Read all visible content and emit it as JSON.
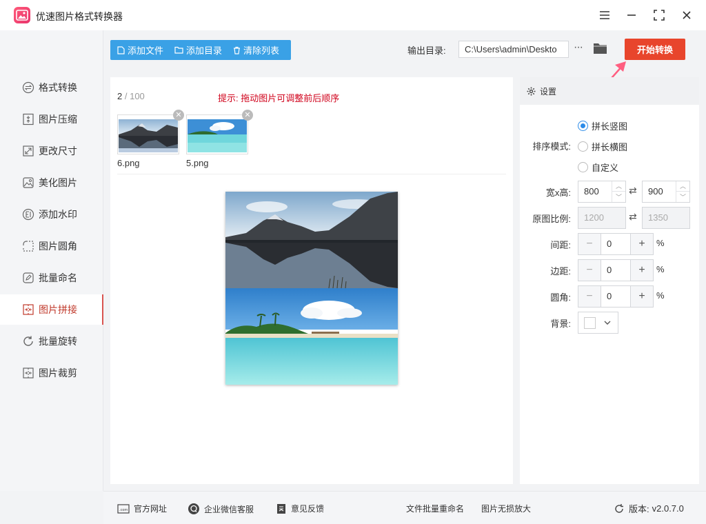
{
  "app": {
    "title": "优速图片格式转换器",
    "logo_icon": "image-icon"
  },
  "window_controls": [
    "menu-icon",
    "minimize-icon",
    "maximize-icon",
    "close-icon"
  ],
  "sidebar": {
    "active_index": 7,
    "items": [
      {
        "label": "格式转换",
        "icon": "format-convert-icon"
      },
      {
        "label": "图片压缩",
        "icon": "compress-icon"
      },
      {
        "label": "更改尺寸",
        "icon": "resize-icon"
      },
      {
        "label": "美化图片",
        "icon": "beautify-icon"
      },
      {
        "label": "添加水印",
        "icon": "watermark-icon"
      },
      {
        "label": "图片圆角",
        "icon": "rounded-corner-icon"
      },
      {
        "label": "批量命名",
        "icon": "rename-icon"
      },
      {
        "label": "图片拼接",
        "icon": "stitch-icon"
      },
      {
        "label": "批量旋转",
        "icon": "rotate-icon"
      },
      {
        "label": "图片裁剪",
        "icon": "crop-icon"
      }
    ]
  },
  "toolbar": {
    "add_file": "添加文件",
    "add_folder": "添加目录",
    "clear_list": "清除列表",
    "output_label": "输出目录:",
    "output_path": "C:\\Users\\admin\\Deskto",
    "more": "···",
    "start": "开始转换"
  },
  "file_list": {
    "count": "2",
    "max": "/ 100",
    "hint": "提示: 拖动图片可调整前后顺序",
    "files": [
      {
        "name": "6.png",
        "scene": "mountain-lake"
      },
      {
        "name": "5.png",
        "scene": "tropical-beach"
      }
    ]
  },
  "settings": {
    "title": "设置",
    "sort_mode_label": "排序模式:",
    "sort_modes": [
      "拼长竖图",
      "拼长横图",
      "自定义"
    ],
    "sort_mode_selected": 0,
    "size_label": "宽x高:",
    "width": "800",
    "height": "900",
    "ratio_label": "原图比例:",
    "ratio_width": "1200",
    "ratio_height": "1350",
    "spacing_label": "间距:",
    "spacing": "0",
    "margin_label": "边距:",
    "margin": "0",
    "corner_label": "圆角:",
    "corner": "0",
    "percent": "%",
    "background_label": "背景:",
    "background_color": "#ffffff"
  },
  "footer": {
    "website": "官方网址",
    "wechat_support": "企业微信客服",
    "feedback": "意见反馈",
    "batch_rename": "文件批量重命名",
    "lossless_enlarge": "图片无损放大",
    "version_label": "版本:",
    "version": "v2.0.7.0"
  },
  "colors": {
    "accent_blue": "#3aa1e6",
    "start_red": "#e8452c",
    "active_red": "#c0392b",
    "hint_red": "#d0021b"
  }
}
